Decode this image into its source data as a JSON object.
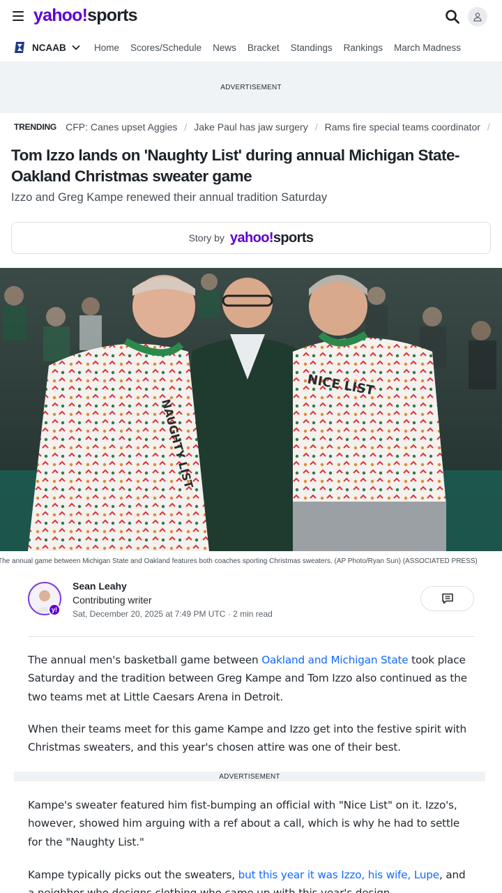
{
  "header": {
    "logo_main": "yahoo!",
    "logo_suffix": "sports",
    "search_icon": "search-icon",
    "account_icon": "user-icon"
  },
  "nav": {
    "league": "NCAAB",
    "items": [
      "Home",
      "Scores/Schedule",
      "News",
      "Bracket",
      "Standings",
      "Rankings",
      "March Madness"
    ]
  },
  "ads": {
    "top": "ADVERTISEMENT",
    "mid": "ADVERTISEMENT"
  },
  "trending": {
    "label": "TRENDING",
    "items": [
      "CFP: Canes upset Aggies",
      "Jake Paul has jaw surgery",
      "Rams fire special teams coordinator"
    ]
  },
  "article": {
    "headline": "Tom Izzo lands on 'Naughty List' during annual Michigan State-Oakland Christmas sweater game",
    "subheadline": "Izzo and Greg Kampe renewed their annual tradition Saturday",
    "story_by_label": "Story by",
    "story_by_logo_main": "yahoo!",
    "story_by_logo_suffix": "sports",
    "caption": "The annual game between Michigan State and Oakland features both coaches sporting Christmas sweaters. (AP Photo/Ryan Sun) (ASSOCIATED PRESS)",
    "author": {
      "name": "Sean Leahy",
      "role": "Contributing writer",
      "date": "Sat, December 20, 2025 at 7:49 PM UTC",
      "read_time": "2 min read"
    },
    "p1_before": "The annual men's basketball game between ",
    "p1_link": "Oakland and Michigan State",
    "p1_after": " took place Saturday and the tradition between Greg Kampe and Tom Izzo also continued as the two teams met at Little Caesars Arena in Detroit.",
    "p2": "When their teams meet for this game Kampe and Izzo get into the festive spirit with Christmas sweaters, and this year's chosen attire was one of their best.",
    "p3": "Kampe's sweater featured him fist-bumping an official with \"Nice List\" on it. Izzo's, however, showed him arguing with a ref about a call, which is why he had to settle for the \"Naughty List.\"",
    "p4_before": "Kampe typically picks out the sweaters, ",
    "p4_link": "but this year it was Izzo, his wife, Lupe",
    "p4_after": ", and a neighbor who designs clothing who came up with this year's design."
  },
  "photo": {
    "sweater_left_text": "NAUGHTY LIST",
    "sweater_right_text": "NICE LIST"
  },
  "colors": {
    "brand": "#6001d2",
    "link": "#0f69ff",
    "ad_bg": "#f0f3f5"
  }
}
